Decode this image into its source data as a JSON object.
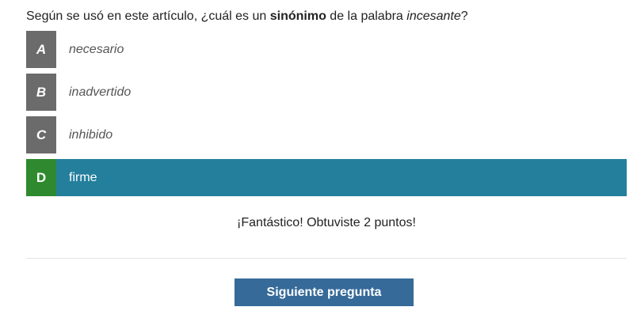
{
  "question": {
    "prefix": "Según se usó en este artículo, ¿cuál es un ",
    "bold_word": "sinónimo",
    "middle": " de la palabra ",
    "italic_word": "incesante",
    "suffix": "?"
  },
  "options": [
    {
      "letter": "A",
      "text": "necesario"
    },
    {
      "letter": "B",
      "text": "inadvertido"
    },
    {
      "letter": "C",
      "text": "inhibido"
    },
    {
      "letter": "D",
      "text": "firme"
    }
  ],
  "selected_option": "D",
  "feedback": "¡Fantástico! Obtuviste 2 puntos!",
  "next_button_label": "Siguiente pregunta",
  "colors": {
    "selected_row": "#237f9c",
    "selected_letter": "#2f8a2f",
    "letter_default": "#6b6b6b",
    "button": "#356a99"
  }
}
